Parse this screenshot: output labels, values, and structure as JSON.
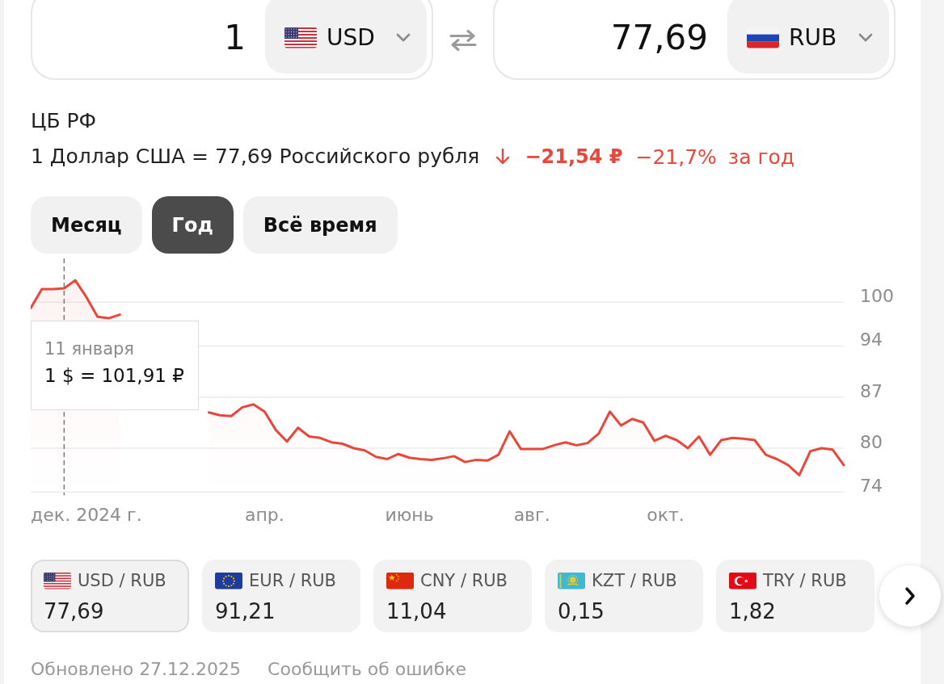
{
  "converter": {
    "from": {
      "amount": "1",
      "currency": "USD"
    },
    "to": {
      "amount": "77,69",
      "currency": "RUB"
    }
  },
  "source": "ЦБ РФ",
  "rate": {
    "text": "1 Доллар США = 77,69 Российского рубля",
    "decrease": true,
    "change": "−21,54 ₽",
    "change_percent": "−21,7%",
    "period": "за год"
  },
  "periods": [
    {
      "label": "Месяц",
      "selected": false
    },
    {
      "label": "Год",
      "selected": true
    },
    {
      "label": "Всё время",
      "selected": false
    }
  ],
  "chart": {
    "chart_data": {
      "type": "area",
      "categories": [
        null,
        null,
        null,
        null,
        null,
        "дек. 2024 г.",
        null,
        null,
        null,
        null,
        null,
        null,
        null,
        null,
        null,
        null,
        null,
        null,
        null,
        null,
        null,
        "апр.",
        null,
        null,
        null,
        null,
        null,
        null,
        null,
        null,
        null,
        null,
        null,
        null,
        "июнь",
        null,
        null,
        null,
        null,
        null,
        null,
        null,
        null,
        null,
        null,
        "авг.",
        null,
        null,
        null,
        null,
        null,
        null,
        null,
        null,
        null,
        null,
        null,
        "окт.",
        null,
        null,
        null,
        null,
        null,
        null,
        null,
        null,
        null,
        null,
        null,
        null,
        null,
        null,
        null,
        null
      ],
      "series": [
        {
          "color": "#e8473b",
          "values": [
            99.2,
            101.8,
            101.8,
            101.9,
            103.0,
            100.7,
            98.0,
            97.8,
            98.3,
            null,
            null,
            null,
            null,
            null,
            null,
            null,
            84.9,
            84.5,
            84.4,
            85.6,
            86.0,
            85.0,
            82.5,
            80.9,
            82.8,
            81.6,
            81.4,
            80.8,
            80.6,
            80.0,
            79.7,
            78.8,
            78.5,
            79.2,
            78.7,
            78.5,
            78.4,
            78.6,
            78.9,
            78.1,
            78.4,
            78.3,
            79.1,
            82.3,
            79.9,
            79.9,
            79.9,
            80.4,
            80.8,
            80.4,
            80.7,
            82.0,
            85.0,
            83.1,
            84.0,
            83.5,
            81.0,
            81.7,
            81.1,
            80.0,
            81.6,
            79.1,
            81.1,
            81.4,
            81.3,
            81.1,
            79.1,
            78.5,
            77.7,
            76.3,
            79.6,
            80.0,
            79.8,
            77.7
          ]
        }
      ],
      "ylim": [
        74,
        106
      ],
      "yticks": [
        100,
        94,
        87,
        80,
        74
      ],
      "grid": true,
      "annotations": [
        "11 января",
        "1 $ = 101,91 ₽"
      ]
    }
  },
  "pairs": [
    {
      "label": "USD / RUB",
      "value": "77,69",
      "selected": true
    },
    {
      "label": "EUR / RUB",
      "value": "91,21",
      "selected": false
    },
    {
      "label": "CNY / RUB",
      "value": "11,04",
      "selected": false
    },
    {
      "label": "KZT / RUB",
      "value": "0,15",
      "selected": false
    },
    {
      "label": "TRY / RUB",
      "value": "1,82",
      "selected": false
    }
  ],
  "footer": {
    "updated": "Обновлено 27.12.2025",
    "report_link": "Сообщить об ошибке"
  }
}
